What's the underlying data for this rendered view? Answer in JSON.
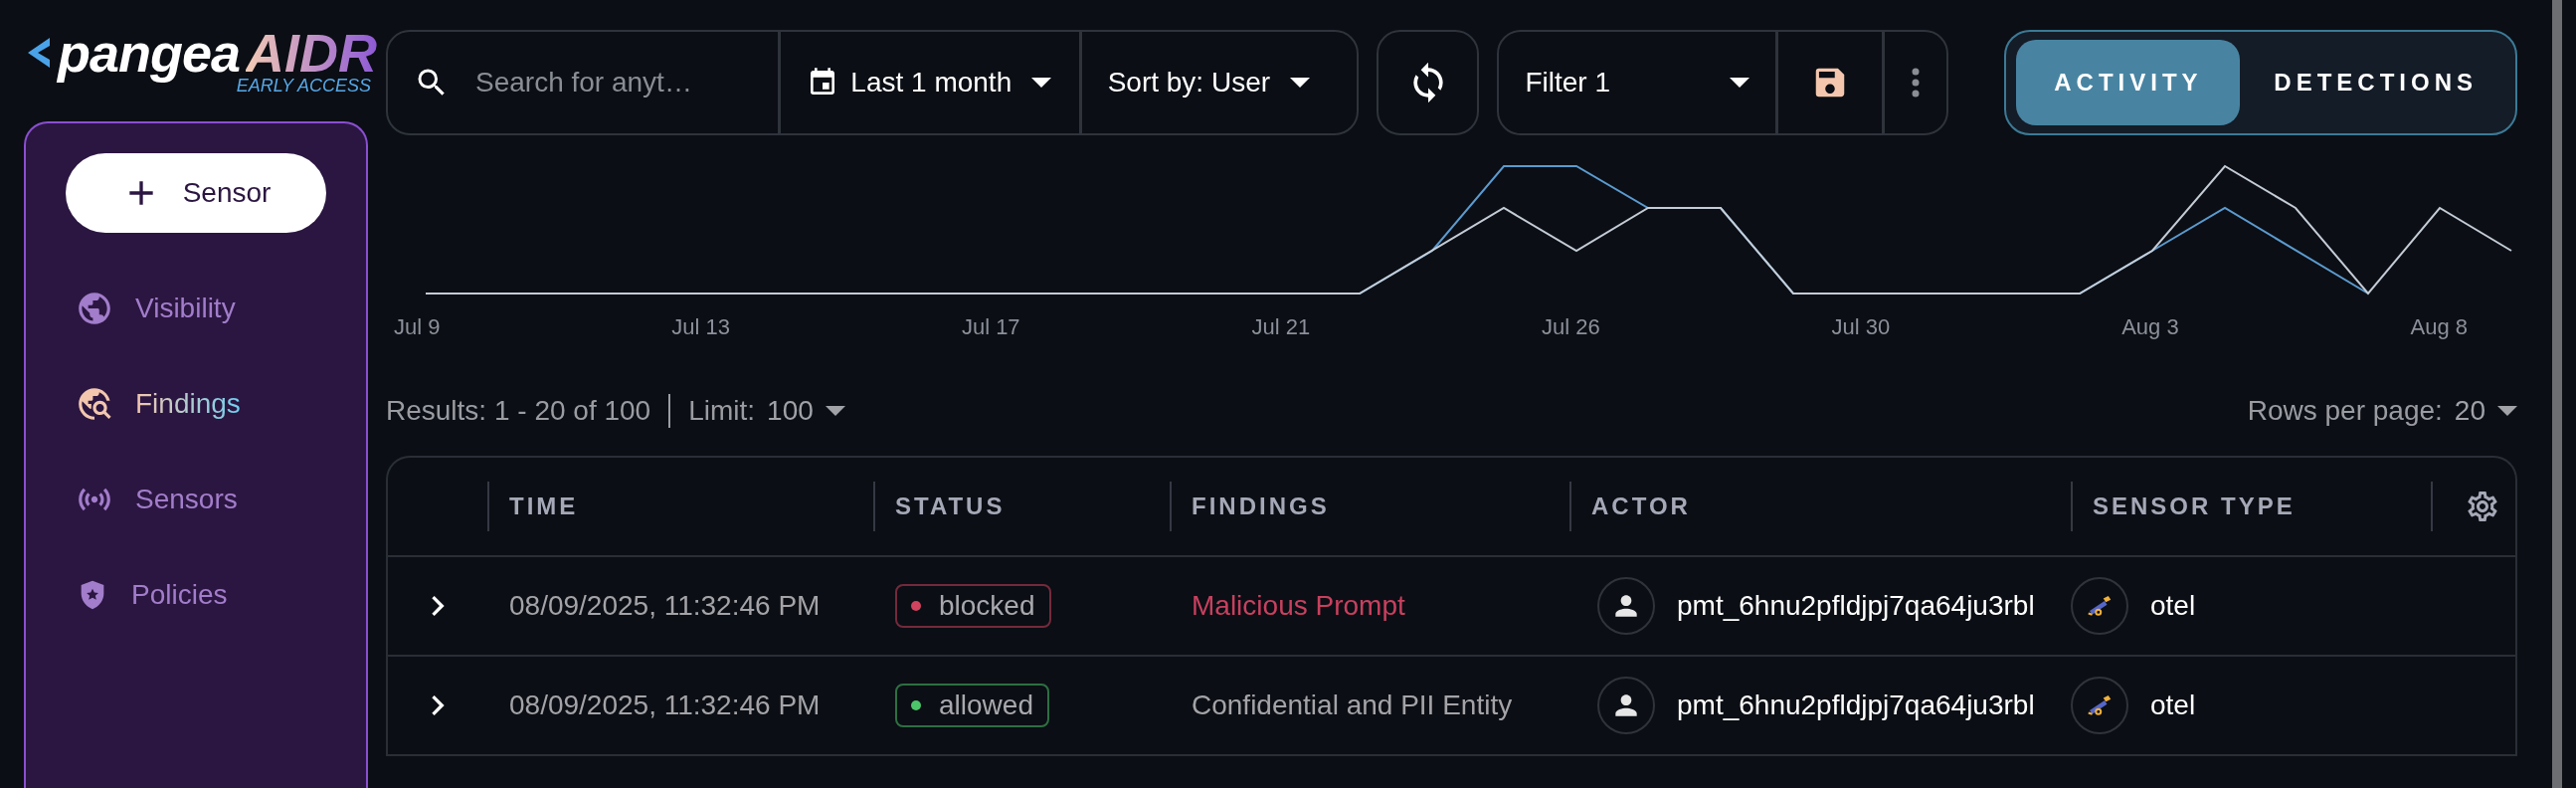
{
  "logo": {
    "wordmark": "pangea",
    "product": "AIDR",
    "tagline": "EARLY ACCESS"
  },
  "sidebar": {
    "action_button": "Sensor",
    "items": [
      {
        "label": "Visibility",
        "selected": false
      },
      {
        "label": "Findings",
        "selected": true
      },
      {
        "label": "Sensors",
        "selected": false
      },
      {
        "label": "Policies",
        "selected": false
      }
    ]
  },
  "toolbar": {
    "search": {
      "placeholder": "Search for anyt…"
    },
    "date_range": "Last 1 month",
    "sort": {
      "label": "Sort by:",
      "value": "User"
    },
    "filter": "Filter 1"
  },
  "view_tabs": [
    {
      "label": "ACTIVITY",
      "selected": true
    },
    {
      "label": "DETECTIONS",
      "selected": false
    }
  ],
  "chart": {
    "x_labels": [
      "Jul 9",
      "Jul 13",
      "Jul 17",
      "Jul 21",
      "Jul 26",
      "Jul 30",
      "Aug 3",
      "Aug 8"
    ]
  },
  "results": {
    "summary": "Results: 1 - 20 of 100",
    "limit_label": "Limit:",
    "limit": "100",
    "rows_per_page_label": "Rows per page:",
    "rows_per_page": "20"
  },
  "table": {
    "columns": [
      "TIME",
      "STATUS",
      "FINDINGS",
      "ACTOR",
      "SENSOR TYPE"
    ],
    "rows": [
      {
        "expanded": false,
        "time": "08/09/2025, 11:32:46 PM",
        "status": {
          "label": "blocked",
          "color": "#d0435f"
        },
        "finding": {
          "text": "Malicious Prompt",
          "color": "#c8405f"
        },
        "actor": "pmt_6hnu2pfldjpj7qa64ju3rbl",
        "sensor_type": "otel"
      },
      {
        "expanded": false,
        "time": "08/09/2025, 11:32:46 PM",
        "status": {
          "label": "allowed",
          "color": "#4cc46a"
        },
        "finding": {
          "text": "Confidential and PII Entity",
          "color": "#a3a3a8"
        },
        "actor": "pmt_6hnu2pfldjpj7qa64ju3rbl",
        "sensor_type": "otel"
      }
    ]
  }
}
